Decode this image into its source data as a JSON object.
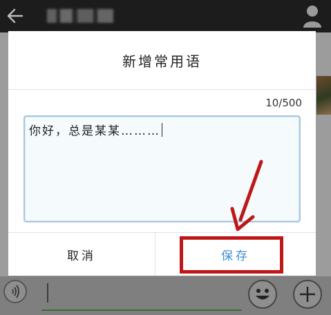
{
  "topbar": {
    "back_icon": "arrow-left-icon",
    "profile_icon": "person-icon"
  },
  "dialog": {
    "title": "新增常用语",
    "counter": "10/500",
    "input_value": "你好，总是某某………",
    "cancel_label": "取消",
    "save_label": "保存"
  },
  "input_bar": {
    "voice_icon": "voice-icon",
    "emoji_icon": "emoji-icon",
    "add_icon": "plus-icon"
  },
  "colors": {
    "accent": "#3a8fd6",
    "highlight": "#bf1717",
    "topbar": "#1c1c1c"
  }
}
